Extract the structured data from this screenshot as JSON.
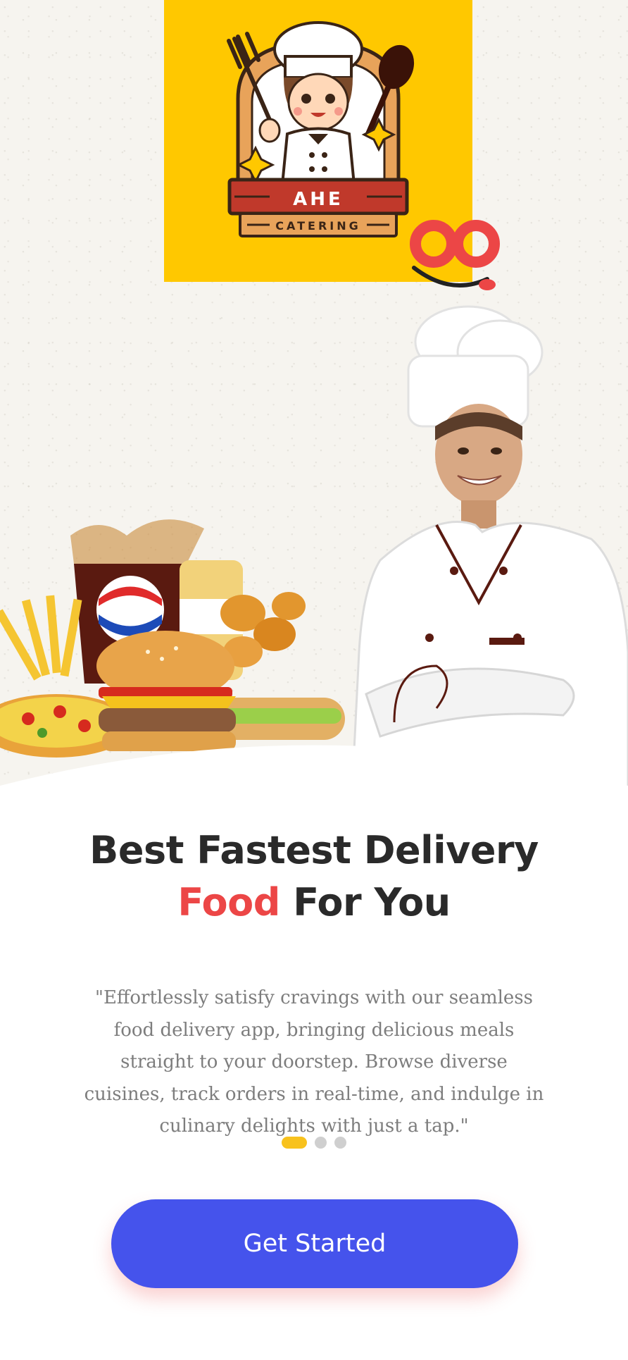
{
  "logo": {
    "brand_name": "AHE",
    "brand_sub": "CATERING",
    "colors": {
      "background": "#ffc800",
      "banner": "#c0392b"
    }
  },
  "brand_mark_icon": "oo-smile-logo",
  "hero": {
    "food_icon": "fast-food-combo",
    "chef_icon": "smiling-chef"
  },
  "headline": {
    "line1": "Best Fastest Delivery",
    "accent": "Food",
    "line2_rest": " For You"
  },
  "description": "\"Effortlessly satisfy cravings with our seamless food delivery app, bringing delicious meals straight to your doorstep. Browse diverse cuisines, track orders in real-time, and indulge in culinary delights with just a tap.\"",
  "pagination": {
    "current": 1,
    "total": 3
  },
  "cta": {
    "label": "Get Started"
  },
  "colors": {
    "accent_red": "#ec4646",
    "primary_blue": "#4553ec",
    "dot_active": "#f8c21d",
    "dot_inactive": "#cfcfcf"
  }
}
